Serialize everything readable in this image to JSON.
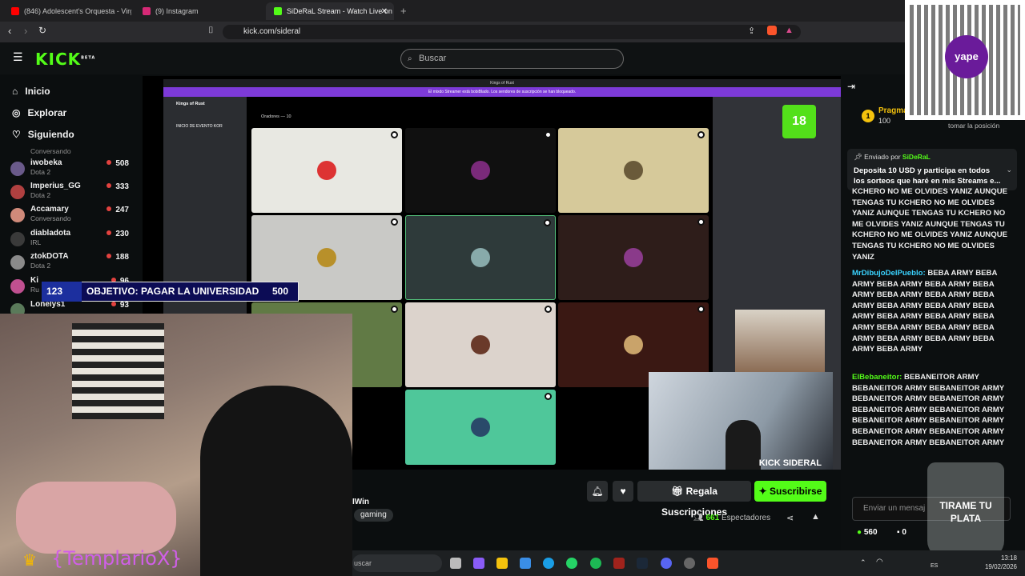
{
  "browser": {
    "tabs": [
      {
        "label": "(846) Adolescent's Orquesta - Virgen",
        "color": "#ff0000"
      },
      {
        "label": "(9) Instagram",
        "color": "#d62976"
      },
      {
        "label": "SiDeRaL Stream - Watch Live on",
        "color": "#53fc18"
      }
    ],
    "url": "kick.com/sideral"
  },
  "header": {
    "logo": "KICK",
    "logo_badge": "BETA",
    "search_placeholder": "Buscar"
  },
  "sidebar": {
    "nav": [
      {
        "label": "Inicio",
        "icon": "home-icon"
      },
      {
        "label": "Explorar",
        "icon": "compass-icon"
      },
      {
        "label": "Siguiendo",
        "icon": "heart-icon"
      }
    ],
    "channels": [
      {
        "name": "iwobeka",
        "category": "Dota 2",
        "viewers": "508",
        "color": "#6a5a8a"
      },
      {
        "name": "Imperius_GG",
        "category": "Dota 2",
        "viewers": "333",
        "color": "#b04040"
      },
      {
        "name": "Accamary",
        "category": "Conversando",
        "viewers": "247",
        "color": "#d08a7a"
      },
      {
        "name": "diabladota",
        "category": "IRL",
        "viewers": "230",
        "color": "#3a3a3a"
      },
      {
        "name": "ztokDOTA",
        "category": "Dota 2",
        "viewers": "188",
        "color": "#8a8a8a"
      },
      {
        "name": "Ki",
        "category": "Ru",
        "viewers": "96",
        "color": "#c05090"
      },
      {
        "name": "Lonelys1",
        "category": "",
        "viewers": "93",
        "color": "#5a7a5a"
      }
    ]
  },
  "stream": {
    "goal_count": "123",
    "goal_text": "OBJETIVO: PAGAR LA UNIVERSIDAD",
    "goal_target": "500",
    "overlay_name": "{TemplarioX}",
    "pip_label": "KICK SIDERAL",
    "jar_text": "TIRAME TU PLATA",
    "discord": {
      "server": "Kings of Rust",
      "channel": "INICIO DE EVENTO KOR",
      "voice_header": "Oradores — 10",
      "banner": "El mixdo Streamer está bobiBlado. Los sendores de suscripción se han bloqueado."
    }
  },
  "stream_info": {
    "game_prefix": "IWin",
    "tag": "gaming",
    "gift_label": "Regala Suscripciones",
    "subscribe_label": "Suscribirse",
    "viewers_count": "661",
    "viewers_suffix": "Espectadores"
  },
  "chat": {
    "top_user": "Pragma",
    "top_amount": "100",
    "top_note": "tomar la posición",
    "pinned_by": "Enviado por",
    "pinned_user": "SiDeRaL",
    "pinned_text": "Deposita 10 USD y participa en todos los sorteos que haré en mis Streams e...",
    "messages": [
      {
        "user": "",
        "text": "KCHERO NO ME OLVIDES YANIZ AUNQUE TENGAS TU KCHERO NO ME OLVIDES YANIZ AUNQUE TENGAS TU KCHERO NO ME OLVIDES YANIZ AUNQUE TENGAS TU KCHERO NO ME OLVIDES YANIZ AUNQUE TENGAS TU KCHERO NO ME OLVIDES YANIZ"
      },
      {
        "user": "MrDibujoDelPueblo:",
        "text": "BEBA ARMY BEBA ARMY BEBA ARMY BEBA ARMY BEBA ARMY BEBA ARMY BEBA ARMY BEBA ARMY BEBA ARMY BEBA ARMY BEBA ARMY BEBA ARMY BEBA ARMY BEBA ARMY BEBA ARMY BEBA ARMY BEBA ARMY BEBA ARMY BEBA ARMY BEBA ARMY BEBA ARMY"
      },
      {
        "user": "ElBebaneitor:",
        "text": "BEBANEITOR ARMY BEBANEITOR ARMY BEBANEITOR ARMY BEBANEITOR ARMY BEBANEITOR ARMY BEBANEITOR ARMY BEBANEITOR ARMY BEBANEITOR ARMY BEBANEITOR ARMY BEBANEITOR ARMY BEBANEITOR ARMY BEBANEITOR ARMY BEBANEITOR ARMY"
      }
    ],
    "input_placeholder": "Enviar un mensaj",
    "points": "560",
    "other_count": "0"
  },
  "taskbar": {
    "search": "uscar",
    "time": "13:18",
    "date": "19/02/2026",
    "lang": "ES"
  }
}
